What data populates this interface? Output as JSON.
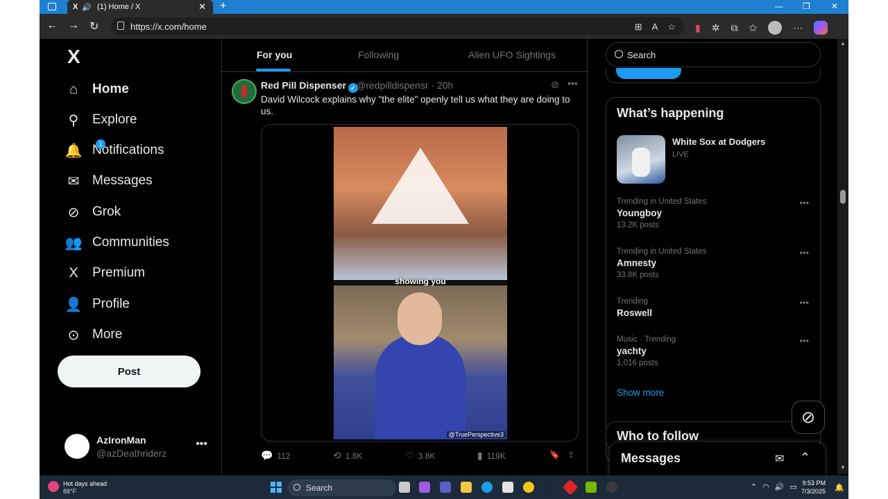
{
  "browser": {
    "tab_title": "(1) Home / X",
    "url": "https://x.com/home",
    "tab_favicon": "X",
    "new_tab": "+",
    "tab_close": "✕"
  },
  "nav": {
    "logo": "X",
    "items": [
      {
        "label": "Home",
        "icon": "home-icon"
      },
      {
        "label": "Explore",
        "icon": "search-icon"
      },
      {
        "label": "Notifications",
        "icon": "bell-icon",
        "badge": "1"
      },
      {
        "label": "Messages",
        "icon": "mail-icon"
      },
      {
        "label": "Grok",
        "icon": "grok-icon"
      },
      {
        "label": "Communities",
        "icon": "people-icon"
      },
      {
        "label": "Premium",
        "icon": "x-icon"
      },
      {
        "label": "Profile",
        "icon": "person-icon"
      },
      {
        "label": "More",
        "icon": "more-circle-icon"
      }
    ],
    "post_button": "Post",
    "account": {
      "name": "AzIronMan",
      "handle": "@azDeathriderz"
    }
  },
  "feed": {
    "tabs": [
      "For you",
      "Following",
      "Alien UFO Sightings"
    ],
    "active_tab": "For you",
    "tweet": {
      "author": "Red Pill Dispenser",
      "handle": "@redpilldispensr",
      "separator": "·",
      "time": "20h",
      "text": "David Wilcock explains why \"the elite\" openly tell us what they are doing to us.",
      "video_caption": "showing you",
      "watermark": "@TruePerspective3",
      "replies": "112",
      "reposts": "1.8K",
      "likes": "3.8K",
      "views": "119K"
    }
  },
  "sidebar": {
    "search_placeholder": "Search",
    "happening_title": "What’s happening",
    "sport": {
      "title": "White Sox at Dodgers",
      "status": "LIVE"
    },
    "trends": [
      {
        "context": "Trending in United States",
        "topic": "Youngboy",
        "posts": "13.2K posts"
      },
      {
        "context": "Trending in United States",
        "topic": "Amnesty",
        "posts": "33.8K posts"
      },
      {
        "context": "Trending",
        "topic": "Roswell",
        "posts": ""
      },
      {
        "context": "Music · Trending",
        "topic": "yachty",
        "posts": "1,016 posts"
      }
    ],
    "show_more": "Show more",
    "who_to_follow": "Who to follow",
    "messages_dock": "Messages"
  },
  "taskbar": {
    "weather_title": "Hot days ahead",
    "weather_temp": "88°F",
    "search": "Search",
    "time": "9:53 PM",
    "date": "7/3/2025"
  },
  "colors": {
    "accent": "#1d9bf0",
    "background": "#000000",
    "text": "#e7e9ea",
    "muted": "#71767b"
  }
}
